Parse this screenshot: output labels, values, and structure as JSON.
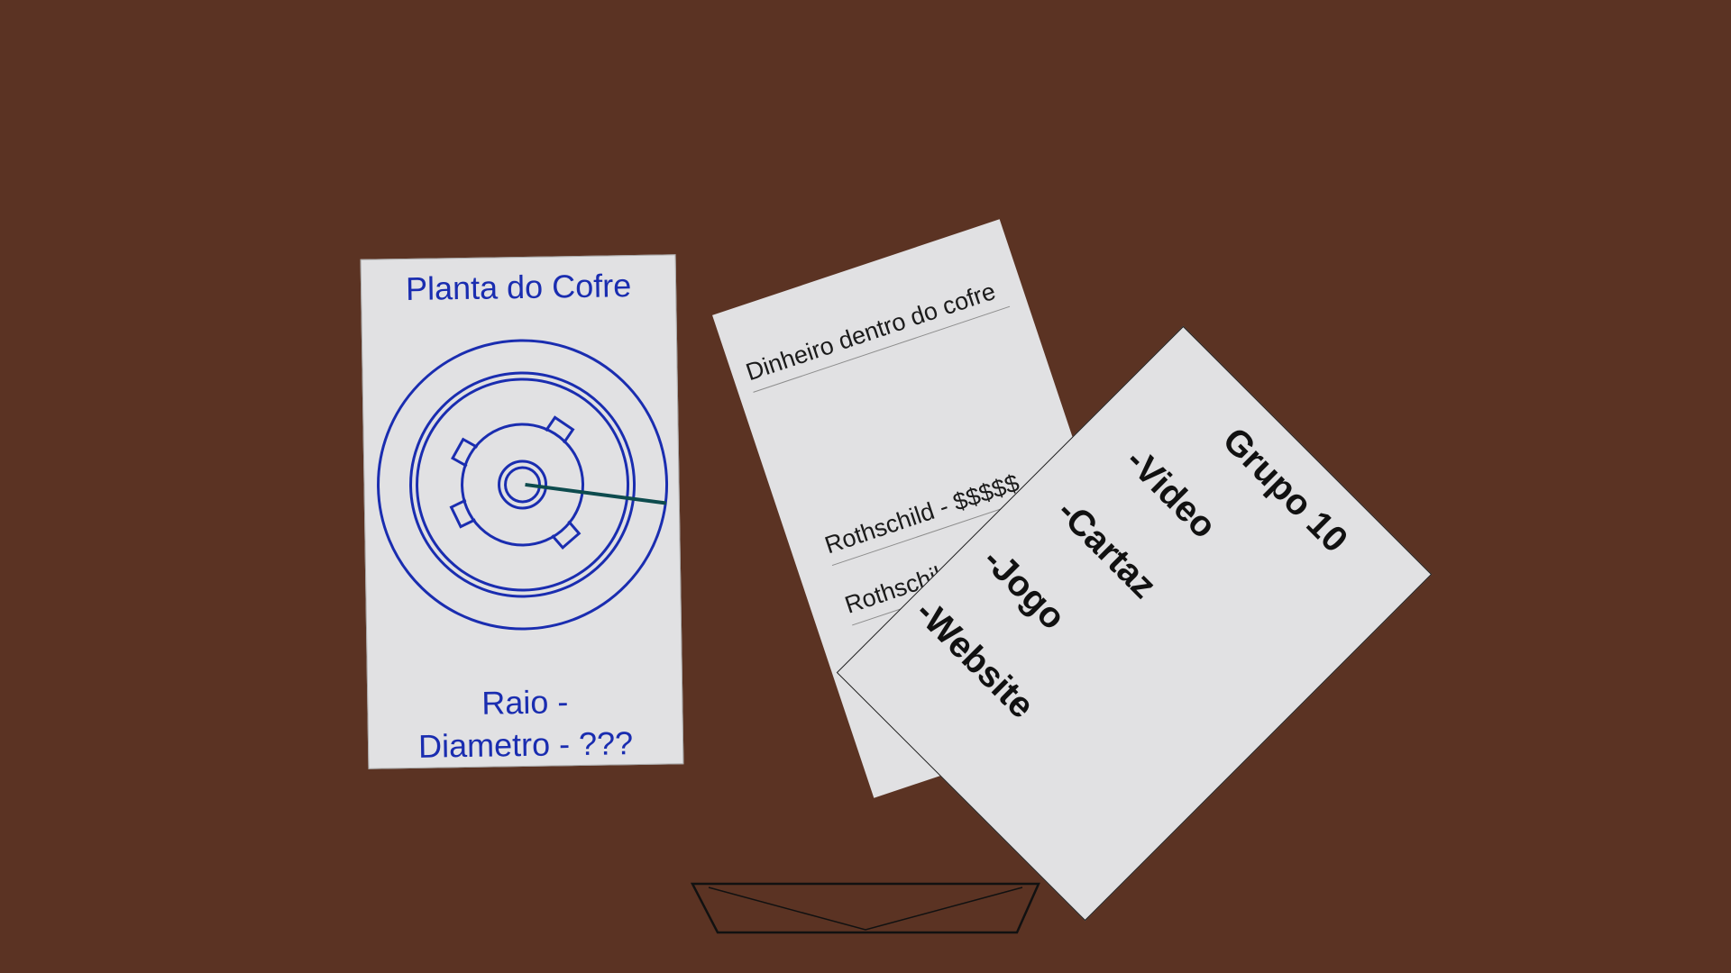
{
  "scene": {
    "background_color": "#5b3323",
    "paper_color": "#e1e1e3"
  },
  "blueprint_card": {
    "title": "Planta do Cofre",
    "radius_label": "Raio -",
    "diameter_label": "Diametro - ???",
    "ink_color": "#1a2db0",
    "pointer_color": "#0d4b4e",
    "icon": "safe-dial-icon"
  },
  "money_card": {
    "title": "Dinheiro dentro do cofre",
    "entries": [
      "Rothschild - $$$$$",
      "Rothschild"
    ]
  },
  "group_card": {
    "title": "Grupo 10",
    "items": [
      "-Video",
      "-Cartaz",
      "-Jogo",
      "-Website"
    ]
  },
  "inventory": {
    "icon": "envelope-tray-icon"
  }
}
